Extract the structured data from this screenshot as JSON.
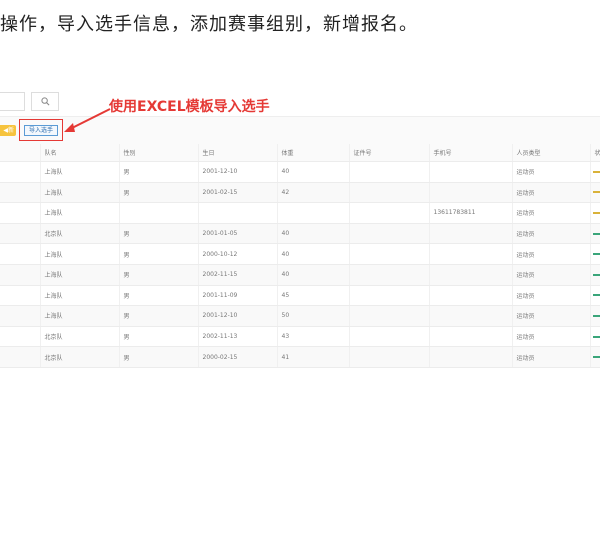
{
  "heading": "操作，导入选手信息，添加赛事组别，新增报名。",
  "annotation": "使用EXCEL模板导入选手",
  "toolbar": {
    "yellow_label": "◀新",
    "import_label": "导入选手"
  },
  "table": {
    "headers": [
      "",
      "队名",
      "性别",
      "生日",
      "体重",
      "证件号",
      "手机号",
      "人员类型",
      "状"
    ],
    "rows": [
      [
        "",
        "上海队",
        "男",
        "2001-12-10",
        "40",
        "",
        "",
        "运动员",
        ""
      ],
      [
        "",
        "上海队",
        "男",
        "2001-02-15",
        "42",
        "",
        "",
        "运动员",
        ""
      ],
      [
        "",
        "上海队",
        "",
        "",
        "",
        "",
        "13611783811",
        "运动员",
        ""
      ],
      [
        "",
        "北京队",
        "男",
        "2001-01-05",
        "40",
        "",
        "",
        "运动员",
        ""
      ],
      [
        "",
        "上海队",
        "男",
        "2000-10-12",
        "40",
        "",
        "",
        "运动员",
        ""
      ],
      [
        "",
        "上海队",
        "男",
        "2002-11-15",
        "40",
        "",
        "",
        "运动员",
        ""
      ],
      [
        "",
        "上海队",
        "男",
        "2001-11-09",
        "45",
        "",
        "",
        "运动员",
        ""
      ],
      [
        "",
        "上海队",
        "男",
        "2001-12-10",
        "50",
        "",
        "",
        "运动员",
        ""
      ],
      [
        "",
        "北京队",
        "男",
        "2002-11-13",
        "43",
        "",
        "",
        "运动员",
        ""
      ],
      [
        "",
        "北京队",
        "男",
        "2000-02-15",
        "41",
        "",
        "",
        "运动员",
        ""
      ]
    ],
    "status_colors": [
      "#d9b23a",
      "#d9b23a",
      "#d9b23a",
      "#3aa57a",
      "#3aa57a",
      "#3aa57a",
      "#3aa57a",
      "#3aa57a",
      "#3aa57a",
      "#3aa57a"
    ]
  },
  "colors": {
    "annotation": "#e53935",
    "import_border": "#5b9bd5",
    "yellow_button": "#f6c33d"
  }
}
